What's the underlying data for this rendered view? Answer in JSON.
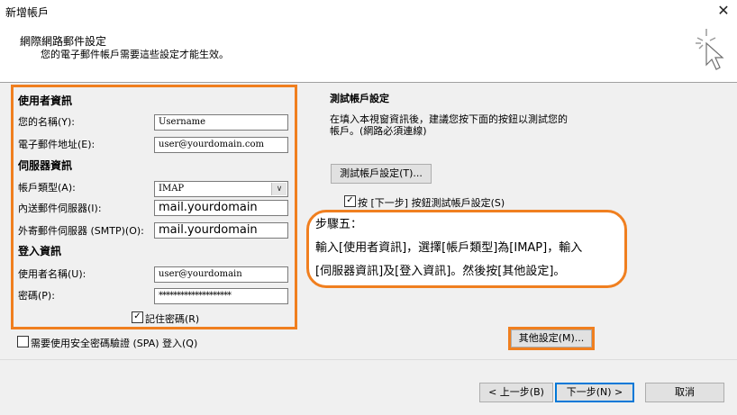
{
  "window": {
    "title": "新增帳戶",
    "close_icon": "close-icon"
  },
  "header": {
    "title": "網際網路郵件設定",
    "subtitle": "您的電子郵件帳戶需要這些設定才能生效。",
    "icon": "cursor-sparkle-icon"
  },
  "user_info": {
    "section_label": "使用者資訊",
    "name_label": "您的名稱(Y):",
    "name_value": "Username",
    "email_label": "電子郵件地址(E):",
    "email_value": "user@yourdomain.com"
  },
  "server_info": {
    "section_label": "伺服器資訊",
    "account_type_label": "帳戶類型(A):",
    "account_type_value": "IMAP",
    "incoming_label": "內送郵件伺服器(I):",
    "incoming_value": "mail.yourdomain",
    "outgoing_label": "外寄郵件伺服器 (SMTP)(O):",
    "outgoing_value": "mail.yourdomain"
  },
  "login_info": {
    "section_label": "登入資訊",
    "username_label": "使用者名稱(U):",
    "username_value": "user@yourdomain",
    "password_label": "密碼(P):",
    "password_value": "********************",
    "remember_label": "記住密碼(R)",
    "remember_checked": true
  },
  "spa": {
    "label": "需要使用安全密碼驗證 (SPA) 登入(Q)",
    "checked": false
  },
  "test": {
    "title": "測試帳戶設定",
    "desc_line1": "在填入本視窗資訊後，建議您按下面的按鈕以測試您的",
    "desc_line2": "帳戶。(網路必須連線)",
    "button_label": "測試帳戶設定(T)...",
    "auto_test_label": "按 [下一步] 按鈕測試帳戶設定(S)",
    "auto_test_checked": true
  },
  "callout": {
    "line1": "步驟五：",
    "line2": "輸入[使用者資訊]，選擇[帳戶類型]為[IMAP]，輸入",
    "line3": "[伺服器資訊]及[登入資訊]。然後按[其他設定]。"
  },
  "more_settings": {
    "label": "其他設定(M)..."
  },
  "footer": {
    "back_label": "< 上一步(B)",
    "next_label": "下一步(N) >",
    "cancel_label": "取消"
  },
  "colors": {
    "highlight": "#f07f1f",
    "dialog_bg": "#f0f0f0",
    "primary_border": "#0078d7"
  }
}
